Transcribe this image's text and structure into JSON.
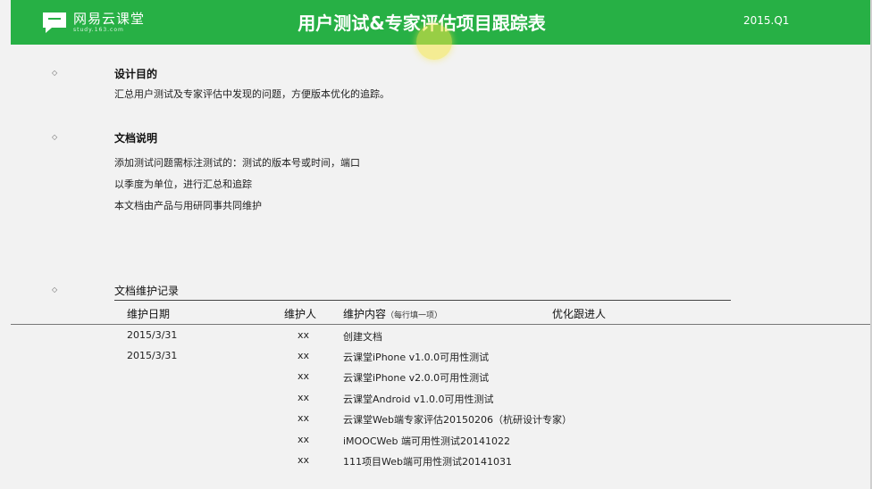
{
  "header": {
    "logo_text": "网易云课堂",
    "logo_sub": "study.163.com",
    "title": "用户测试&专家评估项目跟踪表",
    "period": "2015.Q1"
  },
  "purpose": {
    "title": "设计目的",
    "text": "汇总用户测试及专家评估中发现的问题，方便版本优化的追踪。"
  },
  "notes": {
    "title": "文档说明",
    "lines": [
      "添加测试问题需标注测试的：测试的版本号或时间，端口",
      "以季度为单位，进行汇总和追踪",
      "本文档由产品与用研同事共同维护"
    ]
  },
  "maintenance": {
    "title": "文档维护记录",
    "columns": {
      "date": "维护日期",
      "maintainer": "维护人",
      "content": "维护内容",
      "content_note": "（每行填一项）",
      "follower": "优化跟进人"
    },
    "rows": [
      {
        "date": "2015/3/31",
        "maintainer": "xx",
        "content": "创建文档",
        "follower": ""
      },
      {
        "date": "2015/3/31",
        "maintainer": "xx",
        "content": "云课堂iPhone v1.0.0可用性测试",
        "follower": ""
      },
      {
        "date": "",
        "maintainer": "xx",
        "content": "云课堂iPhone v2.0.0可用性测试",
        "follower": ""
      },
      {
        "date": "",
        "maintainer": "xx",
        "content": "云课堂Android v1.0.0可用性测试",
        "follower": ""
      },
      {
        "date": "",
        "maintainer": "xx",
        "content": "云课堂Web端专家评估20150206（杭研设计专家）",
        "follower": ""
      },
      {
        "date": "",
        "maintainer": "xx",
        "content": "iMOOCWeb 端可用性测试20141022",
        "follower": ""
      },
      {
        "date": "",
        "maintainer": "xx",
        "content": "111项目Web端可用性测试20141031",
        "follower": ""
      }
    ]
  },
  "colors": {
    "header_green": "#27b045",
    "page_bg": "#f2f2f2",
    "cursor_highlight": "#f6e846"
  },
  "icons": {
    "logo": "speech-bubble-logo-icon",
    "bullet": "diamond-bullet-icon"
  }
}
